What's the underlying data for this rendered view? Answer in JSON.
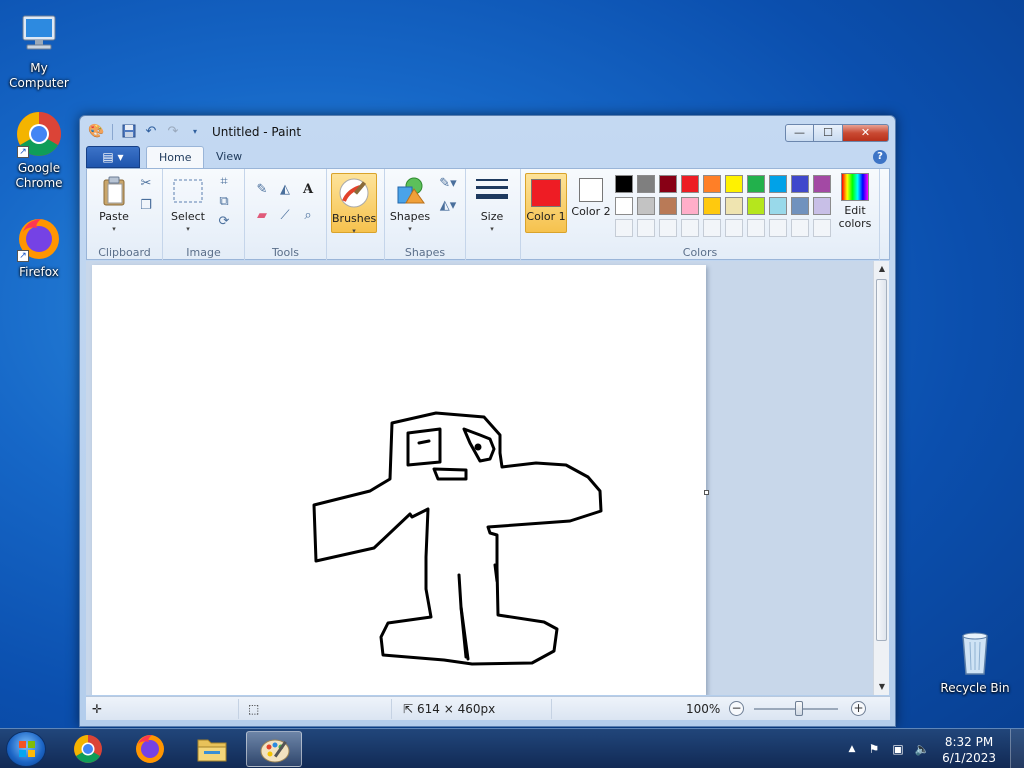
{
  "desktop": {
    "icons": [
      {
        "label": "My Computer"
      },
      {
        "label": "Google Chrome"
      },
      {
        "label": "Firefox"
      },
      {
        "label": "Recycle Bin"
      }
    ]
  },
  "window": {
    "title": "Untitled - Paint",
    "controls": {
      "minimize": "—",
      "maximize": "☐",
      "close": "✕"
    }
  },
  "tabs": [
    {
      "label": "Home"
    },
    {
      "label": "View"
    }
  ],
  "ribbon": {
    "clipboard": {
      "paste": "Paste",
      "group": "Clipboard"
    },
    "image": {
      "select": "Select",
      "group": "Image"
    },
    "tools": {
      "group": "Tools"
    },
    "brushes": {
      "label": "Brushes"
    },
    "shapes": {
      "label": "Shapes",
      "group": "Shapes"
    },
    "size": {
      "label": "Size"
    },
    "colors": {
      "color1_label": "Color 1",
      "color2_label": "Color 2",
      "edit_label": "Edit colors",
      "group": "Colors",
      "color1": "#ee1c24",
      "color2": "#ffffff",
      "palette_row1": [
        "#000000",
        "#7f7f7f",
        "#880015",
        "#ed1c24",
        "#ff7f27",
        "#fff200",
        "#22b14c",
        "#00a2e8",
        "#3f48cc",
        "#a349a4"
      ],
      "palette_row2": [
        "#ffffff",
        "#c3c3c3",
        "#b97a57",
        "#ffaec9",
        "#ffc90e",
        "#efe4b0",
        "#b5e61d",
        "#99d9ea",
        "#7092be",
        "#c8bfe7"
      ]
    }
  },
  "status": {
    "canvas_size": "614 × 460px",
    "zoom": "100%"
  },
  "taskbar": {
    "time": "8:32 PM",
    "date": "6/1/2023"
  }
}
